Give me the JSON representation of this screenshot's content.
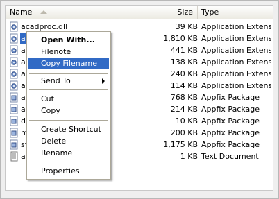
{
  "header": {
    "name": "Name",
    "size": "Size",
    "type": "Type"
  },
  "files": [
    {
      "name": "acadproc.dll",
      "size": "39 KB",
      "type": "Application Extension",
      "icon": "dll-icon"
    },
    {
      "name": "ac",
      "size": "1,810 KB",
      "type": "Application Extension",
      "icon": "dll-icon"
    },
    {
      "name": "ac",
      "size": "441 KB",
      "type": "Application Extension",
      "icon": "dll-icon"
    },
    {
      "name": "ac",
      "size": "138 KB",
      "type": "Application Extension",
      "icon": "dll-icon"
    },
    {
      "name": "ac",
      "size": "240 KB",
      "type": "Application Extension",
      "icon": "dll-icon"
    },
    {
      "name": "ac",
      "size": "114 KB",
      "type": "Application Extension",
      "icon": "dll-icon"
    },
    {
      "name": "ap",
      "size": "768 KB",
      "type": "Appfix Package",
      "icon": "package-icon"
    },
    {
      "name": "ap",
      "size": "214 KB",
      "type": "Appfix Package",
      "icon": "package-icon"
    },
    {
      "name": "dr",
      "size": "10 KB",
      "type": "Appfix Package",
      "icon": "package-icon"
    },
    {
      "name": "ms",
      "size": "200 KB",
      "type": "Appfix Package",
      "icon": "package-icon"
    },
    {
      "name": "sy",
      "size": "1,175 KB",
      "type": "Appfix Package",
      "icon": "package-icon"
    },
    {
      "name": "ac",
      "size": "1 KB",
      "type": "Text Document",
      "icon": "text-document-icon"
    }
  ],
  "context_menu": {
    "open_with": "Open With...",
    "filenote": "Filenote",
    "copy_filename": "Copy Filename",
    "send_to": "Send To",
    "cut": "Cut",
    "copy": "Copy",
    "create_shortcut": "Create Shortcut",
    "delete": "Delete",
    "rename": "Rename",
    "properties": "Properties"
  },
  "colors": {
    "selection": "#316ac5",
    "menu_border": "#aca899"
  }
}
